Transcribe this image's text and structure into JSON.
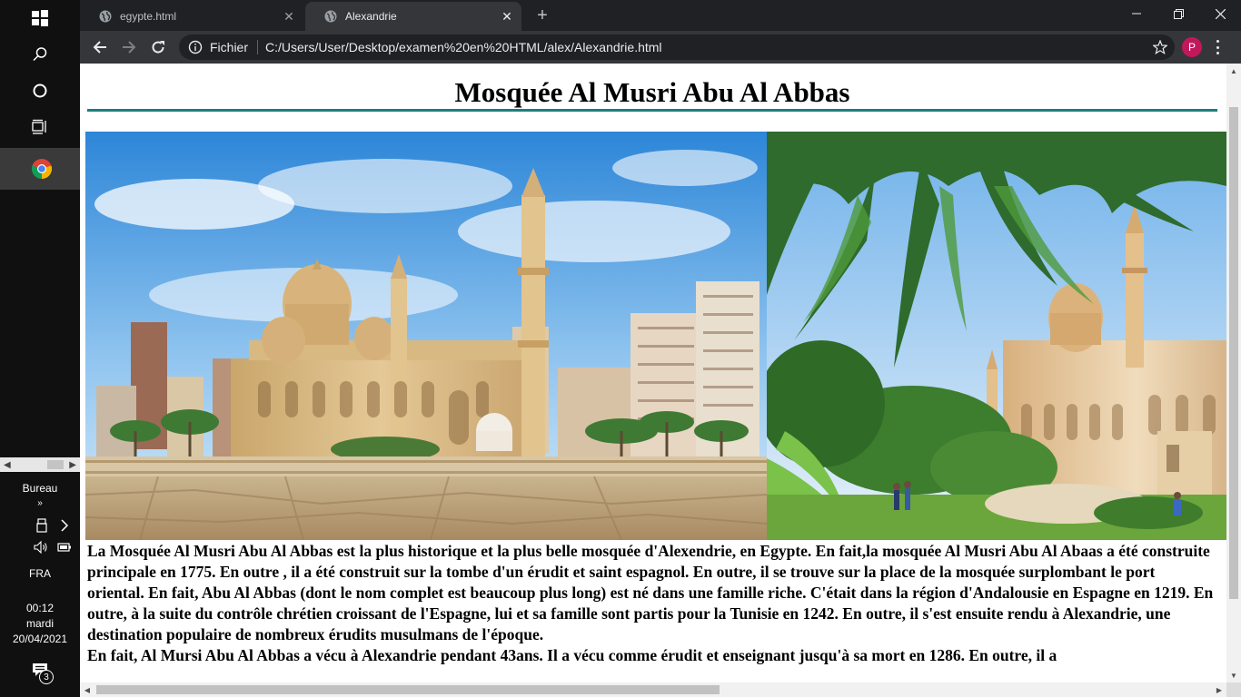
{
  "taskbar": {
    "bureau_label": "Bureau",
    "chevron": "»",
    "language": "FRA",
    "time": "00:12",
    "day": "mardi",
    "date": "20/04/2021",
    "notification_count": "3",
    "icons": [
      "windows-start-icon",
      "search-icon",
      "cortana-icon",
      "task-view-icon",
      "chrome-icon",
      "usb-icon",
      "chevron-right-icon",
      "speaker-icon",
      "battery-icon",
      "action-center-icon"
    ]
  },
  "browser": {
    "tabs": [
      {
        "title": "egypte.html",
        "active": false
      },
      {
        "title": "Alexandrie",
        "active": true
      }
    ],
    "new_tab": "+",
    "scheme_label": "Fichier",
    "url": "C:/Users/User/Desktop/examen%20en%20HTML/alex/Alexandrie.html",
    "profile_initial": "P"
  },
  "page": {
    "title": "Mosquée Al Musri Abu Al Abbas",
    "title_rule_color": "#1b7f7f",
    "photos": [
      {
        "subject": "mosque-front-view-photo"
      },
      {
        "subject": "mosque-through-trees-photo"
      }
    ],
    "paragraphs": [
      "La Mosquée Al Musri Abu Al Abbas est la plus historique et la plus belle mosquée d'Alexendrie, en Egypte. En fait,la mosquée Al Musri Abu Al Abaas a été construite principale en 1775. En outre , il a été construit sur la tombe d'un érudit et saint espagnol. En outre, il se trouve sur la place de la mosquée surplombant le port oriental. En fait, Abu Al Abbas (dont le nom complet est beaucoup plus long) est né dans une famille riche. C'était dans la région d'Andalousie en Espagne en 1219. En outre, à la suite du contrôle chrétien croissant de l'Espagne, lui et sa famille sont partis pour la Tunisie en 1242. En outre, il s'est ensuite rendu à Alexandrie, une destination populaire de nombreux érudits musulmans de l'époque.",
      "En fait, Al Mursi Abu Al Abbas a vécu à Alexandrie pendant 43ans. Il a vécu comme érudit et enseignant jusqu'à sa mort en 1286. En outre, il a"
    ]
  }
}
